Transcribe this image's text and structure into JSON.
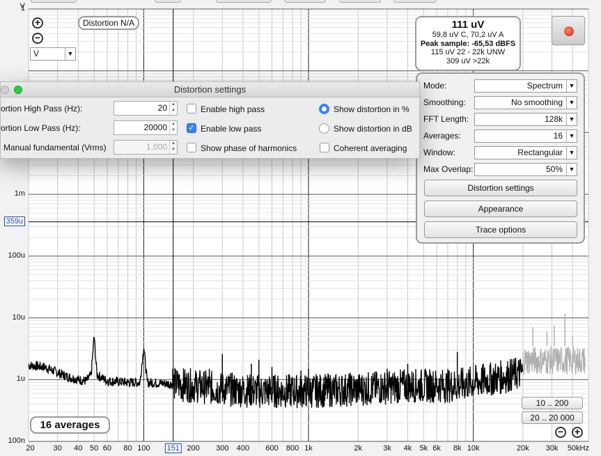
{
  "y_unit": "V",
  "y_ticks": [
    {
      "label": "1",
      "v": 1
    },
    {
      "label": "1m",
      "v": 0.001
    },
    {
      "label": "100u",
      "v": 0.0001
    },
    {
      "label": "10u",
      "v": 1e-05
    },
    {
      "label": "1u",
      "v": 1e-06
    },
    {
      "label": "100n",
      "v": 1e-07
    }
  ],
  "y_cursor": {
    "label": "359u",
    "v": 0.000359
  },
  "x_ticks": [
    {
      "label": "20",
      "f": 20
    },
    {
      "label": "30",
      "f": 30
    },
    {
      "label": "40",
      "f": 40
    },
    {
      "label": "50",
      "f": 50
    },
    {
      "label": "60",
      "f": 60
    },
    {
      "label": "80",
      "f": 80
    },
    {
      "label": "100",
      "f": 100
    },
    {
      "label": "200",
      "f": 200
    },
    {
      "label": "300",
      "f": 300
    },
    {
      "label": "400",
      "f": 400
    },
    {
      "label": "600",
      "f": 600
    },
    {
      "label": "800",
      "f": 800
    },
    {
      "label": "1k",
      "f": 1000
    },
    {
      "label": "2k",
      "f": 2000
    },
    {
      "label": "3k",
      "f": 3000
    },
    {
      "label": "4k",
      "f": 4000
    },
    {
      "label": "5k",
      "f": 5000
    },
    {
      "label": "6k",
      "f": 6000
    },
    {
      "label": "8k",
      "f": 8000
    },
    {
      "label": "10k",
      "f": 10000
    },
    {
      "label": "20k",
      "f": 20000
    },
    {
      "label": "30k",
      "f": 30000
    },
    {
      "label": "50kHz",
      "f": 50000
    }
  ],
  "x_cursor": {
    "label": "151",
    "f": 151
  },
  "distortion_badge": "Distortion N/A",
  "unit_select": {
    "value": "V"
  },
  "readout": {
    "main": "111 uV",
    "line1": "59,8 uV C, 70,2 uV A",
    "line2": "Peak sample: -65,53 dBFS",
    "line3": "115 uV 22 - 22k UNW",
    "line4": "309 uV >22k"
  },
  "settings": {
    "mode": {
      "label": "Mode:",
      "value": "Spectrum"
    },
    "smoothing": {
      "label": "Smoothing:",
      "value": "No  smoothing"
    },
    "fft_length": {
      "label": "FFT Length:",
      "value": "128k"
    },
    "averages": {
      "label": "Averages:",
      "value": "16"
    },
    "window": {
      "label": "Window:",
      "value": "Rectangular"
    },
    "max_overlap": {
      "label": "Max Overlap:",
      "value": "50%"
    },
    "buttons": {
      "distortion": "Distortion settings",
      "appearance": "Appearance",
      "trace_options": "Trace options"
    }
  },
  "dialog": {
    "title": "Distortion settings",
    "high_pass_label": "ortion High Pass (Hz):",
    "high_pass_value": "20",
    "low_pass_label": "ortion Low Pass (Hz):",
    "low_pass_value": "20000",
    "fundamental_label": "Manual fundamental (Vrms)",
    "fundamental_value": "1,000",
    "enable_high_pass": "Enable high pass",
    "enable_low_pass": "Enable low pass",
    "show_phase": "Show phase of harmonics",
    "show_pct": "Show distortion in %",
    "show_db": "Show distortion in dB",
    "coherent": "Coherent averaging",
    "state": {
      "high_pass": false,
      "low_pass": true,
      "phase": false,
      "pct": true,
      "db": false,
      "coherent": false
    }
  },
  "averages_badge": "16 averages",
  "range_buttons": {
    "r1": "10 .. 200",
    "r2": "20 .. 20 000"
  },
  "chart_data": {
    "type": "line",
    "x_scale": "log",
    "y_scale": "log",
    "xlim": [
      20,
      50000
    ],
    "ylim": [
      1e-07,
      1
    ],
    "series": [
      {
        "x": [
          20,
          25,
          30,
          35,
          40,
          45,
          48,
          50,
          52,
          60,
          80,
          95,
          100,
          105,
          150,
          200,
          300,
          500,
          1000,
          2000,
          3000,
          4000,
          5000,
          8000,
          10000,
          15000,
          20000
        ],
        "y": [
          1.7e-06,
          1.6e-06,
          1.3e-06,
          1.1e-06,
          1e-06,
          9.5e-07,
          1.2e-06,
          5.2e-06,
          1.2e-06,
          9.5e-07,
          9e-07,
          9e-07,
          3.5e-06,
          9e-07,
          8.5e-07,
          8e-07,
          7e-07,
          6.5e-07,
          6.5e-07,
          7e-07,
          7.5e-07,
          8e-07,
          8e-07,
          8e-07,
          9e-07,
          1.1e-06,
          1.3e-06
        ]
      }
    ],
    "spurs": [
      {
        "f": 150,
        "y": 1.5e-06
      },
      {
        "f": 250,
        "y": 1.5e-06
      },
      {
        "f": 300,
        "y": 2.6e-06
      },
      {
        "f": 450,
        "y": 1.8e-06
      },
      {
        "f": 500,
        "y": 2.1e-06
      },
      {
        "f": 600,
        "y": 1.6e-06
      },
      {
        "f": 900,
        "y": 1.4e-06
      },
      {
        "f": 1000,
        "y": 1.5e-06
      },
      {
        "f": 3000,
        "y": 1.5e-06
      },
      {
        "f": 4000,
        "y": 1.8e-06
      },
      {
        "f": 8000,
        "y": 2.8e-06
      }
    ],
    "grey_trace": {
      "xlim": [
        20000,
        48000
      ],
      "y_lo": 1.2e-06,
      "y_hi": 3.5e-06,
      "spikes": [
        {
          "f": 23000,
          "y": 7e-06
        },
        {
          "f": 28000,
          "y": 6e-06
        },
        {
          "f": 31000,
          "y": 7.5e-06
        },
        {
          "f": 36000,
          "y": 1.15e-05
        },
        {
          "f": 40000,
          "y": 5e-06
        }
      ]
    },
    "colors": {
      "trace": "#000000",
      "beyond_range": "#b0b0b0",
      "grid": "#c9c9c9",
      "cursor": "#000000"
    }
  }
}
